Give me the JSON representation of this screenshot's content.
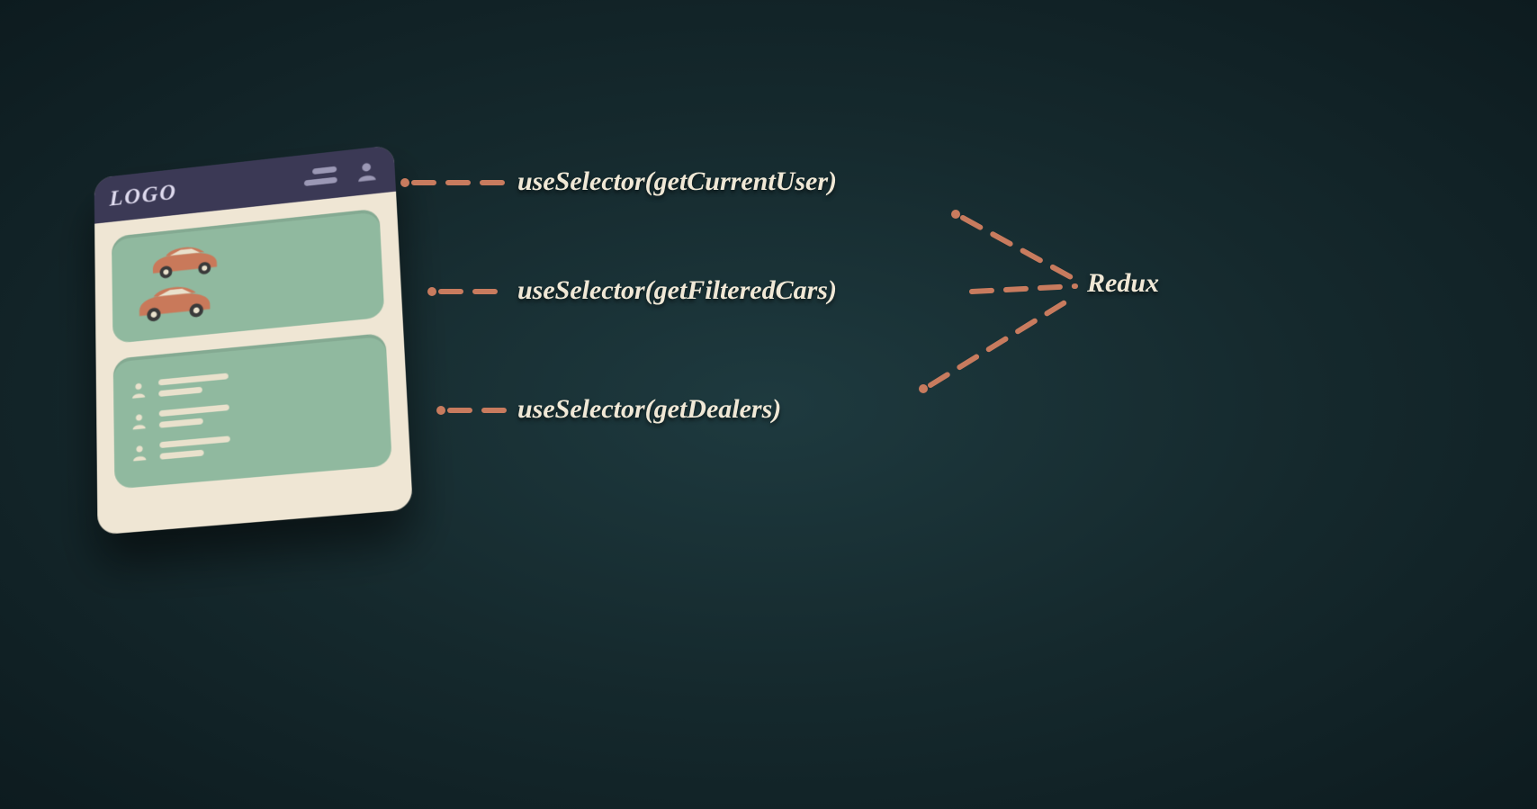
{
  "app": {
    "logo_text": "LOGO"
  },
  "selectors": {
    "user": "useSelector(getCurrentUser)",
    "cars": "useSelector(getFilteredCars)",
    "dealers": "useSelector(getDealers)"
  },
  "store_label": "Redux",
  "colors": {
    "connector": "#c87b5e",
    "navbar": "#3b3955",
    "panel": "#90b99f",
    "card": "#efe6d4",
    "text": "#f0e8d6"
  }
}
